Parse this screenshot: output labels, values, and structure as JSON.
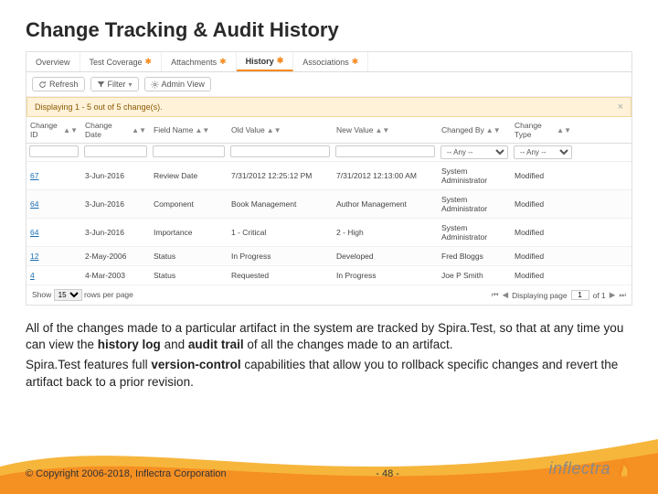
{
  "slide": {
    "title": "Change Tracking & Audit History",
    "body_p1_a": "All of the changes made to a particular artifact in the system are tracked by Spira.Test, so that at any time you can view the ",
    "body_p1_b": "history log",
    "body_p1_c": " and ",
    "body_p1_d": "audit trail",
    "body_p1_e": " of all the changes made to an artifact.",
    "body_p2_a": "Spira.Test features full ",
    "body_p2_b": "version-control",
    "body_p2_c": " capabilities that allow you to rollback specific changes and revert the artifact back to a prior revision."
  },
  "app": {
    "tabs": [
      {
        "label": "Overview",
        "starred": false,
        "active": false
      },
      {
        "label": "Test Coverage",
        "starred": true,
        "active": false
      },
      {
        "label": "Attachments",
        "starred": true,
        "active": false
      },
      {
        "label": "History",
        "starred": true,
        "active": true
      },
      {
        "label": "Associations",
        "starred": true,
        "active": false
      }
    ],
    "toolbar": {
      "refresh": "Refresh",
      "filter": "Filter",
      "admin": "Admin View"
    },
    "banner": {
      "text": "Displaying 1 - 5 out of 5 change(s).",
      "close": "×"
    },
    "columns": [
      "Change ID",
      "Change Date",
      "Field Name",
      "Old Value",
      "New Value",
      "Changed By",
      "Change Type"
    ],
    "filters": {
      "any": "-- Any --"
    },
    "rows": [
      {
        "id": "67",
        "date": "3-Jun-2016",
        "field": "Review Date",
        "old": "7/31/2012 12:25:12 PM",
        "new": "7/31/2012 12:13:00 AM",
        "by": "System Administrator",
        "type": "Modified"
      },
      {
        "id": "64",
        "date": "3-Jun-2016",
        "field": "Component",
        "old": "Book Management",
        "new": "Author Management",
        "by": "System Administrator",
        "type": "Modified"
      },
      {
        "id": "64",
        "date": "3-Jun-2016",
        "field": "Importance",
        "old": "1 - Critical",
        "new": "2 - High",
        "by": "System Administrator",
        "type": "Modified"
      },
      {
        "id": "12",
        "date": "2-May-2006",
        "field": "Status",
        "old": "In Progress",
        "new": "Developed",
        "by": "Fred Bloggs",
        "type": "Modified"
      },
      {
        "id": "4",
        "date": "4-Mar-2003",
        "field": "Status",
        "old": "Requested",
        "new": "In Progress",
        "by": "Joe P Smith",
        "type": "Modified"
      }
    ],
    "footer": {
      "show": "Show",
      "page_size": "15",
      "rows_per_page": "rows per page",
      "displaying_page": "Displaying page",
      "page_num": "1",
      "of": "of 1",
      "first": "⏮",
      "prev": "◀",
      "next": "▶",
      "last": "⏭"
    }
  },
  "footer": {
    "copyright": "© Copyright 2006-2018, Inflectra Corporation",
    "page": "- 48 -",
    "logo_text": "inflectra"
  }
}
